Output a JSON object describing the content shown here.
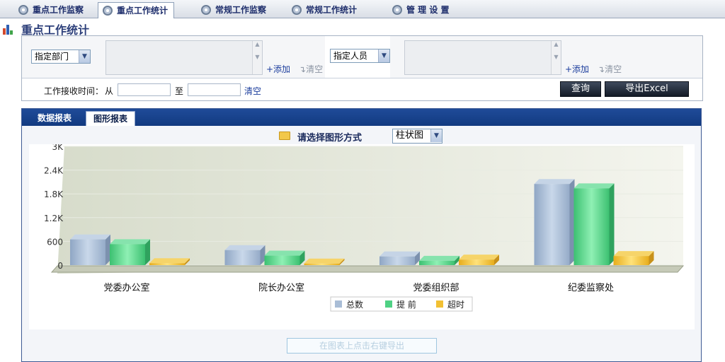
{
  "top_tabs": [
    {
      "label": "重点工作监察",
      "active": false
    },
    {
      "label": "重点工作统计",
      "active": true
    },
    {
      "label": "常规工作监察",
      "active": false
    },
    {
      "label": "常规工作统计",
      "active": false
    },
    {
      "label": "管 理 设 置",
      "active": false
    }
  ],
  "page_title": "重点工作统计",
  "filters": {
    "dept_select": "指定部门",
    "person_select": "指定人员",
    "add_label": "+添加",
    "clear_label": "清空",
    "time_label": "工作接收时间：",
    "from_label": "从",
    "to_label": "至",
    "time_clear": "清空",
    "query_button": "查询",
    "export_button": "导出Excel"
  },
  "report_tabs": [
    {
      "label": "数据报表",
      "active": false
    },
    {
      "label": "图形报表",
      "active": true
    }
  ],
  "chart_choice": {
    "label": "请选择图形方式",
    "value": "柱状图"
  },
  "export_tip": "在图表上点击右键导出",
  "colors": {
    "total": "#a9bdd6",
    "early": "#4fd184",
    "overdue": "#f2c033",
    "header": "#1f4b99"
  },
  "chart_data": {
    "type": "bar",
    "title": "",
    "xlabel": "",
    "ylabel": "",
    "categories": [
      "党委办公室",
      "院长办公室",
      "党委组织部",
      "纪委监察处"
    ],
    "series": [
      {
        "name": "总数",
        "values": [
          650,
          380,
          220,
          2050
        ]
      },
      {
        "name": "提 前",
        "values": [
          530,
          240,
          110,
          1940
        ]
      },
      {
        "name": "超时",
        "values": [
          50,
          40,
          140,
          230
        ]
      }
    ],
    "ylim": [
      0,
      3000
    ],
    "yticks": [
      "0",
      "600",
      "1.2K",
      "1.8K",
      "2.4K",
      "3K"
    ],
    "grid": true,
    "legend_position": "bottom"
  }
}
